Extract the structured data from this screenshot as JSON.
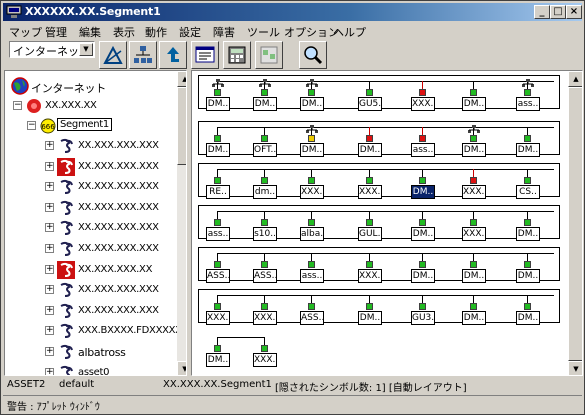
{
  "window": {
    "title": "XXXXXX.XX.Segment1"
  },
  "menu": [
    "マップ",
    "管理",
    "編集",
    "表示",
    "動作",
    "設定",
    "障害",
    "ツール",
    "オプション",
    "ヘルプ"
  ],
  "toolbar": {
    "combo_value": "インターネット"
  },
  "tree": {
    "root": "インターネット",
    "level1": "XX.XXX.XX",
    "segment": "Segment1",
    "items": [
      "XX.XXX.XXX.XXX",
      "XX.XXX.XXX.XXX",
      "XX.XXX.XXX.XXX",
      "XX.XXX.XXX.XXX",
      "XX.XXX.XXX.XXX",
      "XX.XXX.XXX.XXX",
      "XX.XXX.XXX.XX",
      "XX.XXX.XXX.XXX",
      "XX.XXX.XXX.XXX",
      "XXX.BXXXX.FDXXXXX",
      "albatross",
      "asset0"
    ]
  },
  "map": {
    "rows": [
      [
        {
          "l": "DM..",
          "c": "g",
          "h": true
        },
        {
          "l": "DM..",
          "c": "g",
          "h": true
        },
        {
          "l": "DM..",
          "c": "g",
          "h": true
        },
        {
          "l": "GU5..",
          "c": "g"
        },
        {
          "l": "XXX..",
          "c": "r"
        },
        {
          "l": "DM..",
          "c": "g"
        },
        {
          "l": "ass..",
          "c": "g",
          "h": true
        }
      ],
      [
        {
          "l": "DM..",
          "c": "g"
        },
        {
          "l": "OFT..",
          "c": "g"
        },
        {
          "l": "DM..",
          "c": "y",
          "h": true
        },
        {
          "l": "DM..",
          "c": "r"
        },
        {
          "l": "ass..",
          "c": "r"
        },
        {
          "l": "DM..",
          "c": "g",
          "h": true
        },
        {
          "l": "DM..",
          "c": "g"
        }
      ],
      [
        {
          "l": "RE..",
          "c": "g"
        },
        {
          "l": "dm..",
          "c": "g"
        },
        {
          "l": "XXX..",
          "c": "g"
        },
        {
          "l": "XXX..",
          "c": "g"
        },
        {
          "l": "DM..",
          "c": "g",
          "sel": true
        },
        {
          "l": "XXX..",
          "c": "r"
        },
        {
          "l": "CS..",
          "c": "g"
        }
      ],
      [
        {
          "l": "ass..",
          "c": "g"
        },
        {
          "l": "s10..",
          "c": "g"
        },
        {
          "l": "alba..",
          "c": "g"
        },
        {
          "l": "GUL..",
          "c": "g"
        },
        {
          "l": "DM..",
          "c": "g"
        },
        {
          "l": "XXX..",
          "c": "g"
        },
        {
          "l": "DM..",
          "c": "g"
        }
      ],
      [
        {
          "l": "ASS..",
          "c": "g"
        },
        {
          "l": "ASS..",
          "c": "g"
        },
        {
          "l": "ass..",
          "c": "g"
        },
        {
          "l": "XXX..",
          "c": "g"
        },
        {
          "l": "DM..",
          "c": "g"
        },
        {
          "l": "DM..",
          "c": "g"
        },
        {
          "l": "DM..",
          "c": "g"
        }
      ],
      [
        {
          "l": "XXX..",
          "c": "g"
        },
        {
          "l": "XXX..",
          "c": "g"
        },
        {
          "l": "ASS..",
          "c": "g"
        },
        {
          "l": "DM..",
          "c": "g"
        },
        {
          "l": "GU3..",
          "c": "g"
        },
        {
          "l": "DM..",
          "c": "g"
        },
        {
          "l": "DM..",
          "c": "g"
        }
      ],
      [
        {
          "l": "DM..",
          "c": "g"
        },
        {
          "l": "XXX..",
          "c": "g"
        }
      ]
    ]
  },
  "colors": {
    "g": "#22bb22",
    "r": "#dd1111",
    "y": "#eecc00"
  },
  "status": {
    "user": "ASSET2",
    "mode": "default",
    "path": "XX.XXX.XX.Segment1",
    "info": "[隠されたシンボル数: 1] [自動レイアウト]"
  },
  "warning": "警告 : ｱﾌﾟﾚｯﾄ ｳｨﾝﾄﾞｳ"
}
